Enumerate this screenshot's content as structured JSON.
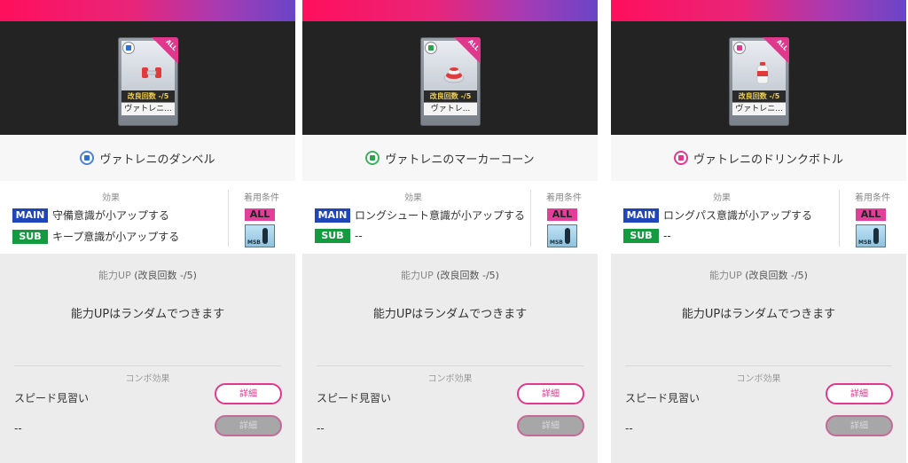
{
  "colors": {
    "accent": "#e0388c",
    "main_tag": "#1f46b8",
    "sub_tag": "#149b3f",
    "card_count_text": "#f3d04f"
  },
  "panels": [
    {
      "icon": "dumbbell-icon",
      "badge_color": "blue",
      "card": {
        "corner": "ALL",
        "count": "改良回数 -/5",
        "name": "ヴァトレニ..."
      },
      "title": "ヴァトレニのダンベル",
      "effects_label": "効果",
      "main_tag": "MAIN",
      "main_text": "守備意識が小アップする",
      "sub_tag": "SUB",
      "sub_text": "キープ意識が小アップする",
      "conditions_label": "着用条件",
      "all_badge": "ALL",
      "msb_label": "MSB",
      "ability_label": "能力UP",
      "ability_count": "(改良回数 -/5)",
      "ability_msg": "能力UPはランダムでつきます",
      "combo_label": "コンボ効果",
      "combo_1": "スピード見習い",
      "combo_2": "--",
      "detail_1": "詳細",
      "detail_2": "詳細"
    },
    {
      "icon": "marker-cone-icon",
      "badge_color": "green",
      "card": {
        "corner": "ALL",
        "count": "改良回数 -/5",
        "name": "ヴァトレ..."
      },
      "title": "ヴァトレニのマーカーコーン",
      "effects_label": "効果",
      "main_tag": "MAIN",
      "main_text": "ロングシュート意識が小アップする",
      "sub_tag": "SUB",
      "sub_text": "--",
      "conditions_label": "着用条件",
      "all_badge": "ALL",
      "msb_label": "MSB",
      "ability_label": "能力UP",
      "ability_count": "(改良回数 -/5)",
      "ability_msg": "能力UPはランダムでつきます",
      "combo_label": "コンボ効果",
      "combo_1": "スピード見習い",
      "combo_2": "--",
      "detail_1": "詳細",
      "detail_2": "詳細"
    },
    {
      "icon": "drink-bottle-icon",
      "badge_color": "pink",
      "card": {
        "corner": "ALL",
        "count": "改良回数 -/5",
        "name": "ヴァトレニ..."
      },
      "title": "ヴァトレニのドリンクボトル",
      "effects_label": "効果",
      "main_tag": "MAIN",
      "main_text": "ロングパス意識が小アップする",
      "sub_tag": "SUB",
      "sub_text": "--",
      "conditions_label": "着用条件",
      "all_badge": "ALL",
      "msb_label": "MSB",
      "ability_label": "能力UP",
      "ability_count": "(改良回数 -/5)",
      "ability_msg": "能力UPはランダムでつきます",
      "combo_label": "コンボ効果",
      "combo_1": "スピード見習い",
      "combo_2": "--",
      "detail_1": "詳細",
      "detail_2": "詳細"
    }
  ]
}
